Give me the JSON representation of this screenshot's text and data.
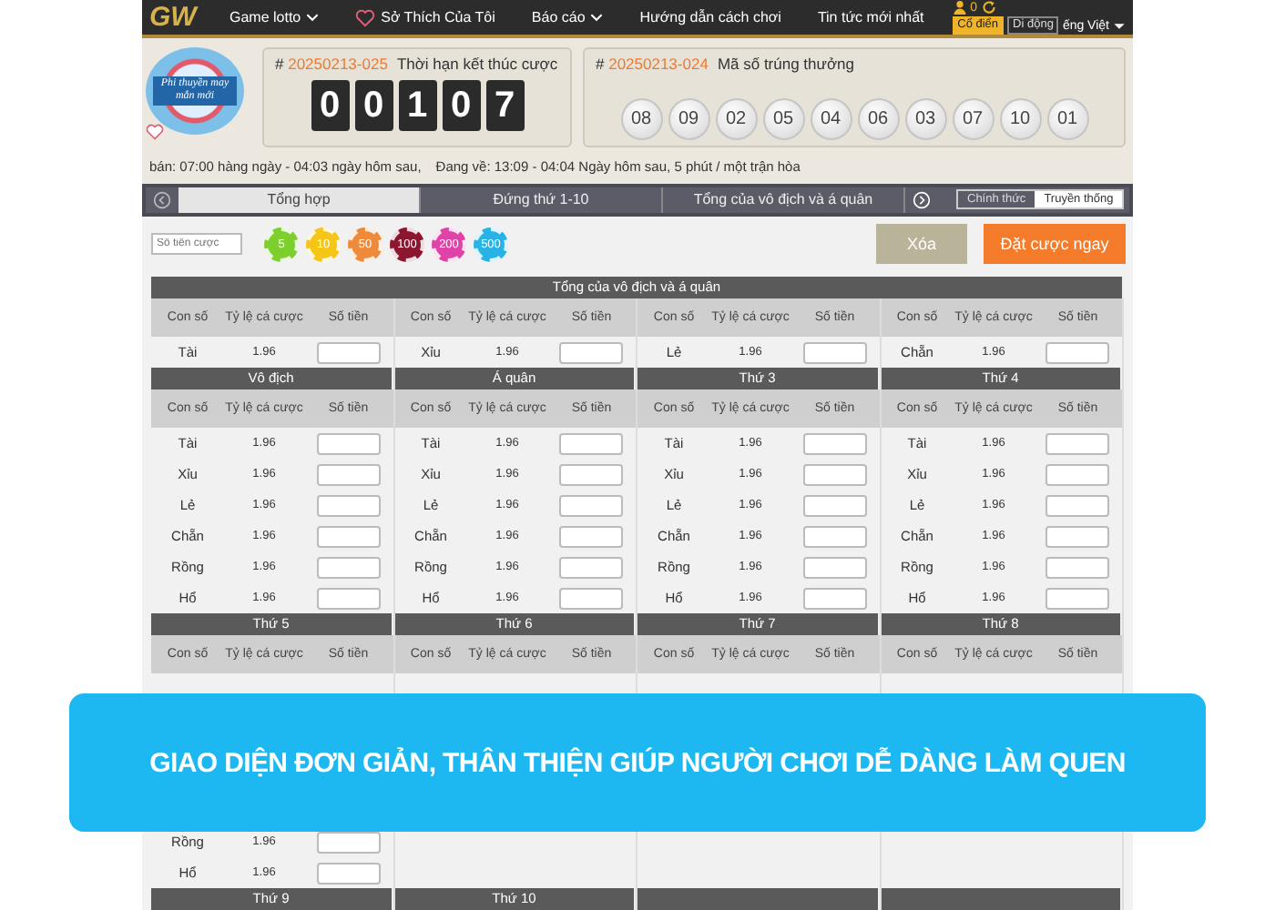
{
  "nav": {
    "logo": "GW",
    "items": [
      {
        "label": "Game lotto",
        "kind": "dropdown"
      },
      {
        "label": "Sở Thích Của Tôi",
        "kind": "favorite"
      },
      {
        "label": "Báo cáo",
        "kind": "dropdown"
      },
      {
        "label": "Hướng dẫn cách chơi",
        "kind": "plain"
      },
      {
        "label": "Tin tức mới nhất",
        "kind": "plain"
      }
    ]
  },
  "account": {
    "balance": "0",
    "modes": [
      {
        "label": "Cổ điển",
        "selected": true
      },
      {
        "label": "Di động",
        "selected": false
      }
    ],
    "language": "ếng Việt"
  },
  "promo_badge": {
    "text": "Phi thuyền may mắn mới"
  },
  "current_draw": {
    "marker": "#",
    "id": "20250213-025",
    "label": "Thời hạn kết thúc cược",
    "countdown": [
      "0",
      "0",
      "1",
      "0",
      "7"
    ]
  },
  "last_draw": {
    "marker": "#",
    "id": "20250213-024",
    "label": "Mã số trúng thưởng",
    "numbers": [
      "08",
      "09",
      "02",
      "05",
      "04",
      "06",
      "03",
      "07",
      "10",
      "01"
    ]
  },
  "schedule": [
    "bán: 07:00 hàng ngày - 04:03 ngày hôm sau,",
    "Đang về: 13:09 - 04:04 Ngày hôm sau, 5 phút / một trận hòa"
  ],
  "tabs": [
    {
      "label": "Tổng hợp",
      "selected": true
    },
    {
      "label": "Đứng thứ 1-10",
      "selected": false
    },
    {
      "label": "Tổng của vô địch và á quân",
      "selected": false
    }
  ],
  "view_modes": [
    {
      "label": "Chính thức",
      "selected": false
    },
    {
      "label": "Truyền thống",
      "selected": true
    }
  ],
  "bet_amount": {
    "placeholder": "Số tiền cược"
  },
  "chips": [
    {
      "label": "5",
      "color": "#7ccf2c"
    },
    {
      "label": "10",
      "color": "#f5c518"
    },
    {
      "label": "50",
      "color": "#ee8a3a"
    },
    {
      "label": "100",
      "color": "#8c1530"
    },
    {
      "label": "200",
      "color": "#e043a8"
    },
    {
      "label": "500",
      "color": "#27b3e6"
    }
  ],
  "buttons": [
    {
      "label": "Xóa",
      "kind": "clear"
    },
    {
      "label": "Đặt cược ngay",
      "kind": "primary"
    }
  ],
  "table": [
    {
      "title": "Tổng của vô địch và á quân",
      "groups": [
        {
          "columns": [
            "Con số",
            "Tỷ lệ cá cược",
            "Số tiền"
          ],
          "rows": [
            {
              "name": "Tài",
              "odds": "1.96"
            }
          ]
        },
        {
          "columns": [
            "Con số",
            "Tỷ lệ cá cược",
            "Số tiền"
          ],
          "rows": [
            {
              "name": "Xỉu",
              "odds": "1.96"
            }
          ]
        },
        {
          "columns": [
            "Con số",
            "Tỷ lệ cá cược",
            "Số tiền"
          ],
          "rows": [
            {
              "name": "Lẻ",
              "odds": "1.96"
            }
          ]
        },
        {
          "columns": [
            "Con số",
            "Tỷ lệ cá cược",
            "Số tiền"
          ],
          "rows": [
            {
              "name": "Chẵn",
              "odds": "1.96"
            }
          ]
        }
      ]
    },
    {
      "groups": [
        {
          "title": "Vô địch",
          "columns": [
            "Con số",
            "Tỷ lệ cá cược",
            "Số tiền"
          ],
          "rows": [
            {
              "name": "Tài",
              "odds": "1.96"
            },
            {
              "name": "Xỉu",
              "odds": "1.96"
            },
            {
              "name": "Lẻ",
              "odds": "1.96"
            },
            {
              "name": "Chẵn",
              "odds": "1.96"
            },
            {
              "name": "Rồng",
              "odds": "1.96"
            },
            {
              "name": "Hổ",
              "odds": "1.96"
            }
          ]
        },
        {
          "title": "Á quân",
          "columns": [
            "Con số",
            "Tỷ lệ cá cược",
            "Số tiền"
          ],
          "rows": [
            {
              "name": "Tài",
              "odds": "1.96"
            },
            {
              "name": "Xỉu",
              "odds": "1.96"
            },
            {
              "name": "Lẻ",
              "odds": "1.96"
            },
            {
              "name": "Chẵn",
              "odds": "1.96"
            },
            {
              "name": "Rồng",
              "odds": "1.96"
            },
            {
              "name": "Hổ",
              "odds": "1.96"
            }
          ]
        },
        {
          "title": "Thứ 3",
          "columns": [
            "Con số",
            "Tỷ lệ cá cược",
            "Số tiền"
          ],
          "rows": [
            {
              "name": "Tài",
              "odds": "1.96"
            },
            {
              "name": "Xỉu",
              "odds": "1.96"
            },
            {
              "name": "Lẻ",
              "odds": "1.96"
            },
            {
              "name": "Chẵn",
              "odds": "1.96"
            },
            {
              "name": "Rồng",
              "odds": "1.96"
            },
            {
              "name": "Hổ",
              "odds": "1.96"
            }
          ]
        },
        {
          "title": "Thứ 4",
          "columns": [
            "Con số",
            "Tỷ lệ cá cược",
            "Số tiền"
          ],
          "rows": [
            {
              "name": "Tài",
              "odds": "1.96"
            },
            {
              "name": "Xỉu",
              "odds": "1.96"
            },
            {
              "name": "Lẻ",
              "odds": "1.96"
            },
            {
              "name": "Chẵn",
              "odds": "1.96"
            },
            {
              "name": "Rồng",
              "odds": "1.96"
            },
            {
              "name": "Hổ",
              "odds": "1.96"
            }
          ]
        }
      ]
    },
    {
      "groups": [
        {
          "title": "Thứ 5",
          "columns": [
            "Con số",
            "Tỷ lệ cá cược",
            "Số tiền"
          ],
          "rows": [
            {
              "name": "Rồng",
              "odds": "1.96"
            },
            {
              "name": "Hổ",
              "odds": "1.96"
            }
          ]
        },
        {
          "title": "Thứ 6",
          "columns": [
            "Con số",
            "Tỷ lệ cá cược",
            "Số tiền"
          ]
        },
        {
          "title": "Thứ 7",
          "columns": [
            "Con số",
            "Tỷ lệ cá cược",
            "Số tiền"
          ]
        },
        {
          "title": "Thứ 8",
          "columns": [
            "Con số",
            "Tỷ lệ cá cược",
            "Số tiền"
          ]
        }
      ]
    },
    {
      "groups": [
        {
          "title": "Thứ 9"
        },
        {
          "title": "Thứ 10"
        }
      ]
    }
  ],
  "banner": {
    "text": "GIAO DIỆN ĐƠN GIẢN, THÂN THIỆN GIÚP NGƯỜI CHƠI DỄ DÀNG LÀM QUEN"
  }
}
